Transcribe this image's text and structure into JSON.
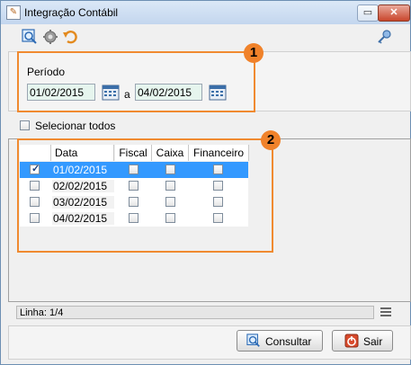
{
  "window": {
    "title": "Integração Contábil",
    "min_label": "▭",
    "close_label": "✕",
    "app_icon": "app-icon"
  },
  "toolbar": {
    "icons": [
      "search-icon",
      "gear-icon",
      "undo-icon",
      "key-icon"
    ]
  },
  "periodo": {
    "label": "Período",
    "start_date": "01/02/2015",
    "separator": "a",
    "end_date": "04/02/2015"
  },
  "annotations": {
    "badge1": "1",
    "badge2": "2",
    "highlight_color": "#f08a30"
  },
  "select_all": {
    "label": "Selecionar todos",
    "checked": false
  },
  "grid": {
    "columns": [
      "Data",
      "Fiscal",
      "Caixa",
      "Financeiro"
    ],
    "rows": [
      {
        "selected": true,
        "data": "01/02/2015",
        "fiscal": false,
        "caixa": false,
        "financeiro": false
      },
      {
        "selected": false,
        "data": "02/02/2015",
        "fiscal": false,
        "caixa": false,
        "financeiro": false
      },
      {
        "selected": false,
        "data": "03/02/2015",
        "fiscal": false,
        "caixa": false,
        "financeiro": false
      },
      {
        "selected": false,
        "data": "04/02/2015",
        "fiscal": false,
        "caixa": false,
        "financeiro": false
      }
    ],
    "selected_row_color": "#3399ff"
  },
  "status": {
    "linha": "Linha: 1/4"
  },
  "buttons": {
    "consultar": "Consultar",
    "sair": "Sair"
  }
}
